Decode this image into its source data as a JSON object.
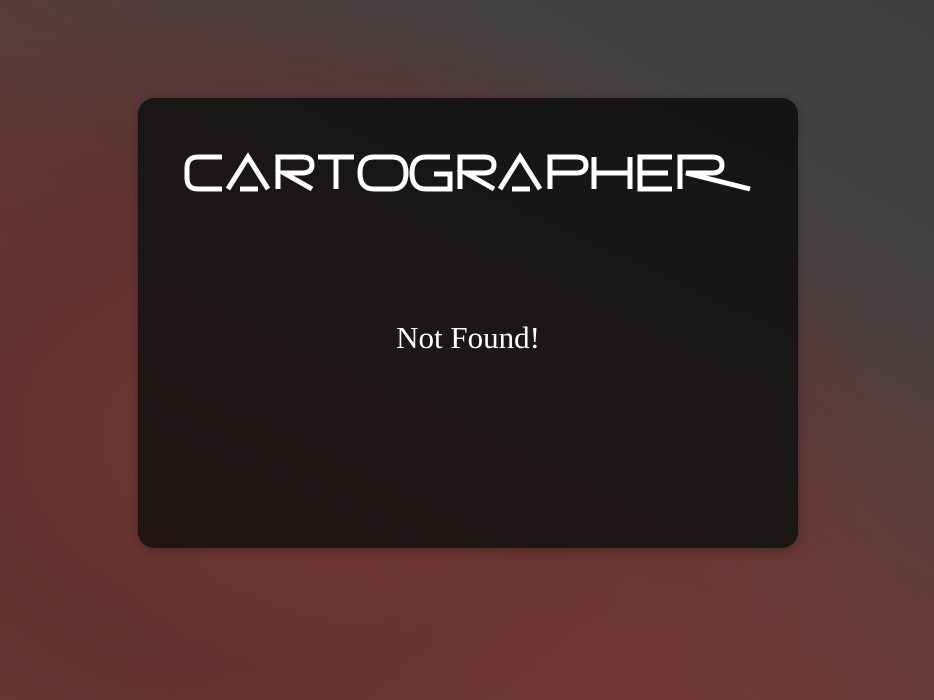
{
  "app": {
    "brand": "CARTOGRAPHER"
  },
  "main": {
    "message": "Not Found!"
  },
  "colors": {
    "card_background": "#1a1617",
    "text": "#ffffff",
    "background_top_right": "#3e3e3f",
    "background_bottom_left": "#6b3a37"
  }
}
